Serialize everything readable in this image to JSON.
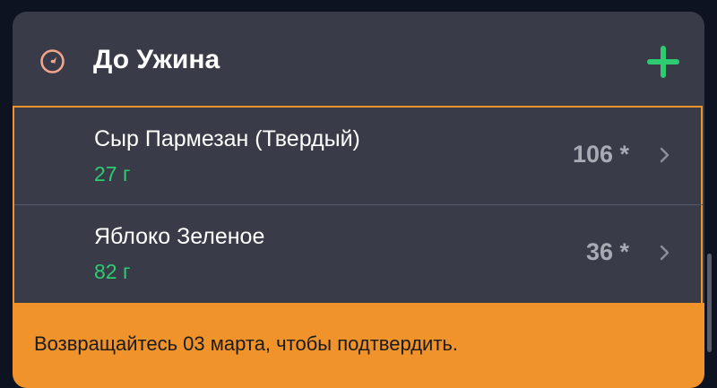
{
  "meal": {
    "title": "До Ужина",
    "icon": "clock-icon",
    "add_icon": "plus-icon"
  },
  "items": [
    {
      "name": "Сыр Пармезан (Твердый)",
      "amount": "27 г",
      "calories": "106 *"
    },
    {
      "name": "Яблоко Зеленое",
      "amount": "82 г",
      "calories": "36 *"
    }
  ],
  "banner": {
    "text": "Возвращайтесь 03 марта, чтобы подтвердить."
  },
  "colors": {
    "card_bg": "#393c48",
    "page_bg": "#0e1322",
    "accent_orange": "#f0932b",
    "accent_green": "#2ecc71",
    "icon_peach": "#f2a58a",
    "calories_gray": "#a8aab4"
  }
}
